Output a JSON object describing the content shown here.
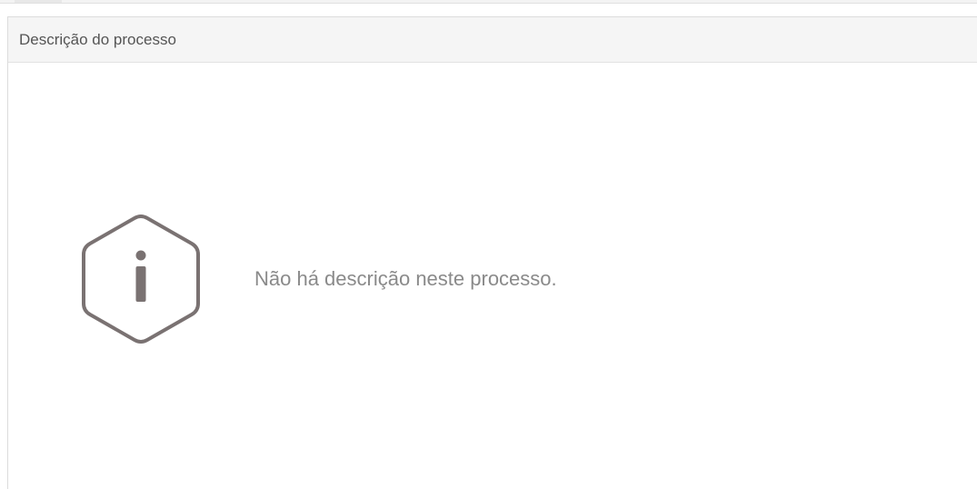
{
  "panel": {
    "title": "Descrição do processo"
  },
  "empty_state": {
    "icon": "info-hexagon-icon",
    "message": "Não há descrição neste processo."
  },
  "colors": {
    "icon_stroke": "#7a7272",
    "message_text": "#8a8a8a",
    "header_bg": "#f5f5f5"
  }
}
